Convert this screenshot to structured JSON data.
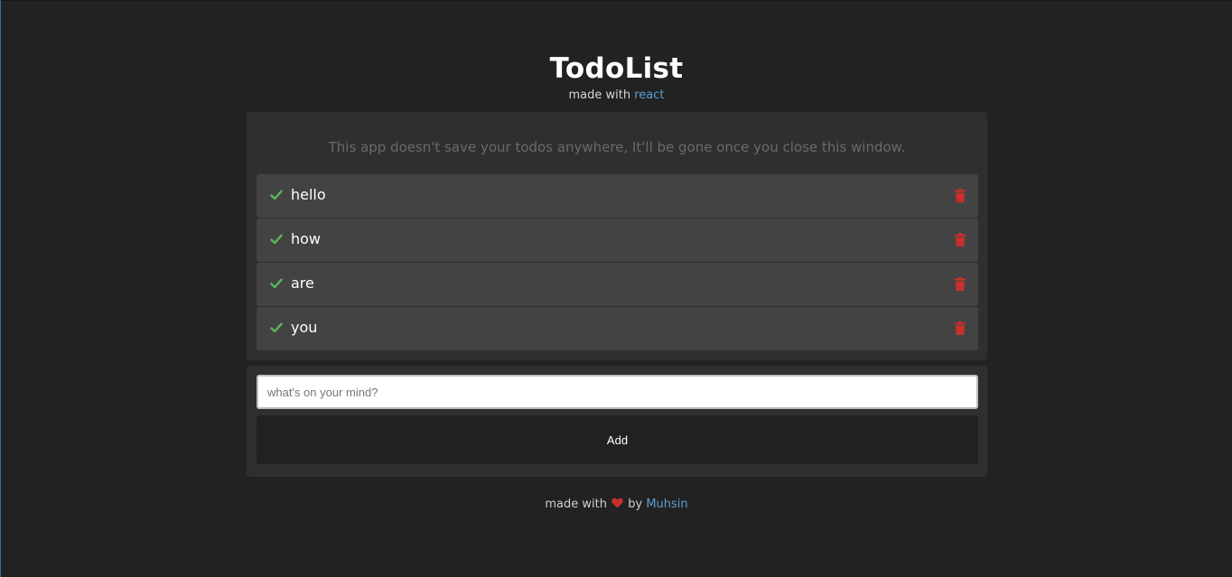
{
  "header": {
    "title": "TodoList",
    "subtitle_prefix": "made with ",
    "subtitle_link": "react"
  },
  "notice": "This app doesn't save your todos anywhere, It'll be gone once you close this window.",
  "todos": [
    {
      "text": "hello",
      "done_icon": "check-icon",
      "delete_icon": "trash-icon"
    },
    {
      "text": "how",
      "done_icon": "check-icon",
      "delete_icon": "trash-icon"
    },
    {
      "text": "are",
      "done_icon": "check-icon",
      "delete_icon": "trash-icon"
    },
    {
      "text": "you",
      "done_icon": "check-icon",
      "delete_icon": "trash-icon"
    }
  ],
  "form": {
    "input_placeholder": "what's on your mind?",
    "input_value": "",
    "add_label": "Add"
  },
  "footer": {
    "prefix": "made with ",
    "heart_icon": "heart-icon",
    "by": " by ",
    "author": "Muhsin"
  },
  "colors": {
    "background": "#222222",
    "panel": "#2f2f2f",
    "item": "#434343",
    "check": "#5cb85c",
    "trash": "#c9302c",
    "link": "#5a9fd4",
    "heart": "#c9302c"
  }
}
